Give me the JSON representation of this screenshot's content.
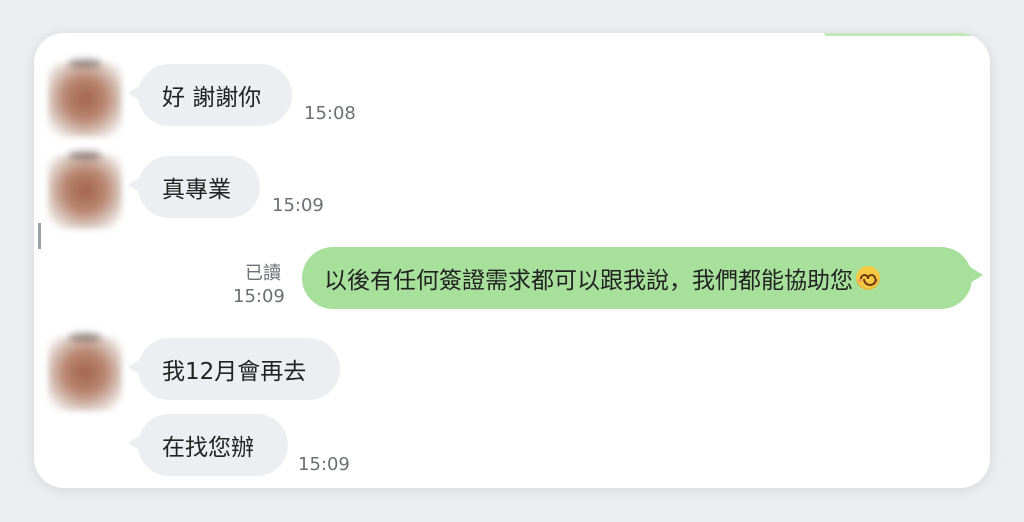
{
  "chat": {
    "messages": [
      {
        "text": "好 謝謝你",
        "time": "15:08"
      },
      {
        "text": "真專業",
        "time": "15:09"
      },
      {
        "text": "以後有任何簽證需求都可以跟我說，我們都能協助您",
        "read": "已讀",
        "time": "15:09",
        "emoji": "smiling-face-emoji"
      },
      {
        "text": "我12月會再去"
      },
      {
        "text": "在找您辦",
        "time": "15:09"
      }
    ]
  },
  "colors": {
    "incoming_bubble": "#eceef1",
    "outgoing_bubble": "#a6e09a"
  }
}
